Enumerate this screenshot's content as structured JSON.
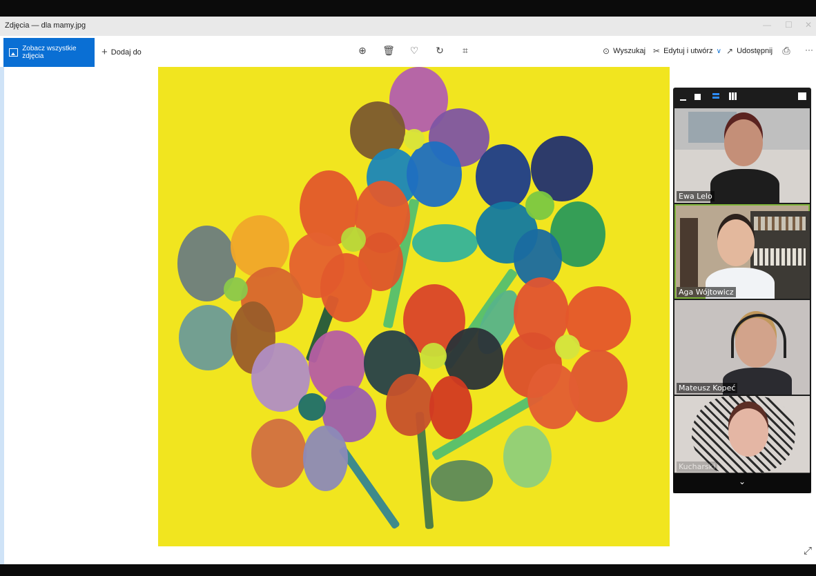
{
  "window": {
    "title": "Zdjęcia — dla mamy.jpg",
    "minimize_glyph": "—",
    "maximize_glyph": "☐",
    "close_glyph": "✕"
  },
  "toolbar": {
    "see_all_label": "Zobacz wszystkie zdjęcia",
    "add_to_label": "Dodaj do",
    "add_icon": "+",
    "zoom_icon": "⊕",
    "delete_icon": "🗑",
    "favorite_icon": "♡",
    "rotate_icon": "↻",
    "crop_icon": "⌗",
    "search_label": "Wyszukaj",
    "search_icon": "⊙",
    "edit_label": "Edytuj i utwórz",
    "edit_icon": "✂",
    "edit_chevron": "∨",
    "share_label": "Udostępnij",
    "share_icon": "↗",
    "print_icon": "⎙",
    "more_icon": "···"
  },
  "viewer": {
    "expand_icon": "⤢"
  },
  "zoom_panel": {
    "participants": [
      {
        "name": "Ewa Lelo",
        "active": false
      },
      {
        "name": "Aga Wójtowicz",
        "active": true
      },
      {
        "name": "Mateusz Kopeć",
        "active": false
      },
      {
        "name": "Kucharski",
        "active": false
      }
    ],
    "scroll_icon": "⌄"
  },
  "colors": {
    "accent": "#0a6fd4",
    "photo_background": "#f1e51f",
    "active_speaker_border": "#7fb53a"
  }
}
